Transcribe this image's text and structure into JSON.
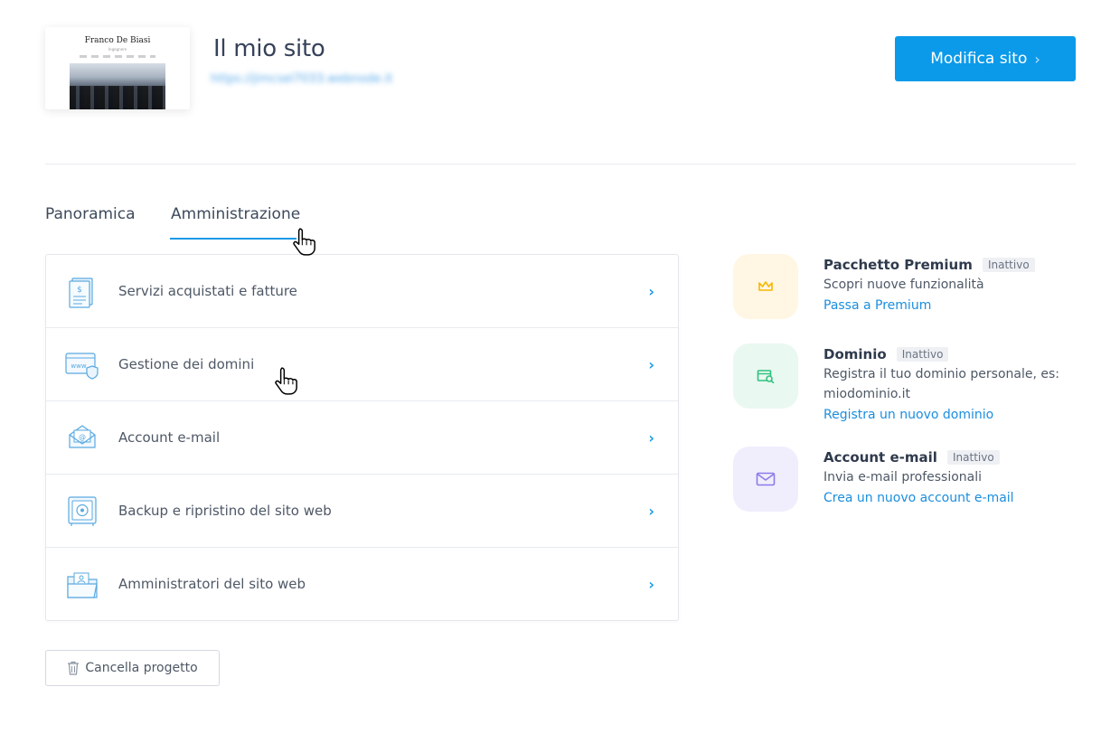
{
  "header": {
    "thumbnail": {
      "site_name": "Franco De Biasi",
      "tagline": "Ingegnere"
    },
    "title": "Il mio sito",
    "url": "https://jimcsel7033.webnode.it",
    "edit_button": {
      "label": "Modifica sito",
      "chevron": "›"
    }
  },
  "tabs": [
    {
      "label": "Panoramica",
      "active": false
    },
    {
      "label": "Amministrazione",
      "active": true
    }
  ],
  "admin_list": [
    {
      "label": "Servizi acquistati e fatture",
      "icon": "invoice-icon",
      "chevron": "›"
    },
    {
      "label": "Gestione dei domini",
      "icon": "domain-www-icon",
      "chevron": "›"
    },
    {
      "label": "Account e-mail",
      "icon": "email-envelope-icon",
      "chevron": "›"
    },
    {
      "label": "Backup e ripristino del sito web",
      "icon": "backup-safe-icon",
      "chevron": "›"
    },
    {
      "label": "Amministratori del sito web",
      "icon": "admin-folder-icon",
      "chevron": "›"
    }
  ],
  "features": [
    {
      "title": "Pacchetto Premium",
      "status": "Inattivo",
      "desc": "Scopri nuove funzionalità",
      "link": "Passa a Premium",
      "icon": "crown-icon",
      "color": "#f5b800",
      "bg": "#fff6e3"
    },
    {
      "title": "Dominio",
      "status": "Inattivo",
      "desc": "Registra il tuo dominio personale, es: miodominio.it",
      "link": "Registra un nuovo dominio",
      "icon": "domain-search-icon",
      "color": "#2ec27e",
      "bg": "#e9f8f0"
    },
    {
      "title": "Account e-mail",
      "status": "Inattivo",
      "desc": "Invia e-mail professionali",
      "link": "Crea un nuovo account e-mail",
      "icon": "mail-icon",
      "color": "#8b7be8",
      "bg": "#f0eefd"
    }
  ],
  "delete_button": {
    "label": "Cancella progetto",
    "icon": "trash-icon"
  },
  "colors": {
    "accent": "#0b9ae9",
    "link": "#1b8ede"
  }
}
